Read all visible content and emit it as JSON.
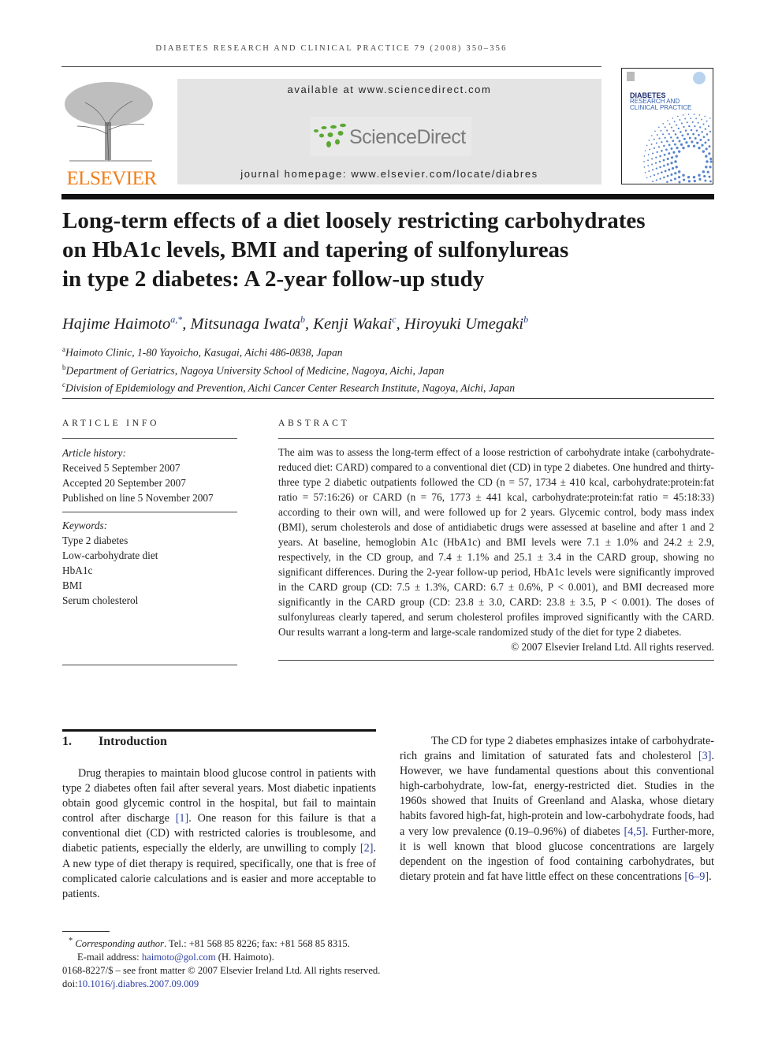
{
  "running_head": "DIABETES RESEARCH AND CLINICAL PRACTICE 79 (2008) 350–356",
  "banner": {
    "available": "available at www.sciencedirect.com",
    "sciencedirect": "ScienceDirect",
    "homepage": "journal homepage: www.elsevier.com/locate/diabres",
    "publisher": "ELSEVIER",
    "brand_color": "#f07f1a",
    "sd_green": "#5aa832"
  },
  "cover": {
    "line1": "DIABETES",
    "line2": "RESEARCH AND",
    "line3": "CLINICAL PRACTICE"
  },
  "title": [
    "Long-term effects of a diet loosely restricting carbohydrates",
    "on HbA1c levels, BMI and tapering of sulfonylureas",
    "in type 2 diabetes: A 2-year follow-up study"
  ],
  "authors": [
    {
      "name": "Hajime Haimoto",
      "sup": "a,*"
    },
    {
      "name": "Mitsunaga Iwata",
      "sup": "b"
    },
    {
      "name": "Kenji Wakai",
      "sup": "c"
    },
    {
      "name": "Hiroyuki Umegaki",
      "sup": "b"
    }
  ],
  "affiliations": [
    {
      "sup": "a",
      "text": "Haimoto Clinic, 1-80 Yayoicho, Kasugai, Aichi 486-0838, Japan"
    },
    {
      "sup": "b",
      "text": "Department of Geriatrics, Nagoya University School of Medicine, Nagoya, Aichi, Japan"
    },
    {
      "sup": "c",
      "text": "Division of Epidemiology and Prevention, Aichi Cancer Center Research Institute, Nagoya, Aichi, Japan"
    }
  ],
  "article_info": {
    "heading": "ARTICLE INFO",
    "history_label": "Article history:",
    "history": [
      "Received 5 September 2007",
      "Accepted 20 September 2007",
      "Published on line 5 November 2007"
    ],
    "keywords_label": "Keywords:",
    "keywords": [
      "Type 2 diabetes",
      "Low-carbohydrate diet",
      "HbA1c",
      "BMI",
      "Serum cholesterol"
    ]
  },
  "abstract": {
    "heading": "ABSTRACT",
    "text": "The aim was to assess the long-term effect of a loose restriction of carbohydrate intake (carbohydrate-reduced diet: CARD) compared to a conventional diet (CD) in type 2 diabetes. One hundred and thirty-three type 2 diabetic outpatients followed the CD (n = 57, 1734 ± 410 kcal, carbohydrate:protein:fat ratio = 57:16:26) or CARD (n = 76, 1773 ± 441 kcal, carbohydrate:protein:fat ratio = 45:18:33) according to their own will, and were followed up for 2 years. Glycemic control, body mass index (BMI), serum cholesterols and dose of antidiabetic drugs were assessed at baseline and after 1 and 2 years. At baseline, hemoglobin A1c (HbA1c) and BMI levels were 7.1 ± 1.0% and 24.2 ± 2.9, respectively, in the CD group, and 7.4 ± 1.1% and 25.1 ± 3.4 in the CARD group, showing no significant differences. During the 2-year follow-up period, HbA1c levels were significantly improved in the CARD group (CD: 7.5 ± 1.3%, CARD: 6.7 ± 0.6%, P < 0.001), and BMI decreased more significantly in the CARD group (CD: 23.8 ± 3.0, CARD: 23.8 ± 3.5, P < 0.001). The doses of sulfonylureas clearly tapered, and serum cholesterol profiles improved significantly with the CARD. Our results warrant a long-term and large-scale randomized study of the diet for type 2 diabetes.",
    "copyright": "© 2007 Elsevier Ireland Ltd. All rights reserved."
  },
  "introduction": {
    "heading_num": "1.",
    "heading": "Introduction",
    "left": [
      [
        {
          "t": "Drug therapies to maintain blood glucose control in patients with type 2 diabetes often fail after several years. Most diabetic inpatients obtain good glycemic control in the hospital, but fail to maintain control after discharge "
        },
        {
          "t": "[1]",
          "link": true
        },
        {
          "t": ". One reason for this failure is that a conventional diet (CD) with restricted calories is troublesome, and diabetic patients, especially the elderly, are unwilling to comply "
        },
        {
          "t": "[2]",
          "link": true
        },
        {
          "t": ". A new type of diet therapy is required, specifically, one that is free of complicated calorie calculations and is easier and more acceptable to patients."
        }
      ]
    ],
    "right": [
      [
        {
          "t": "The CD for type 2 diabetes emphasizes intake of carbohydrate-rich grains and limitation of saturated fats and cholesterol "
        },
        {
          "t": "[3]",
          "link": true
        },
        {
          "t": ". However, we have fundamental questions about this conventional high-carbohydrate, low-fat, energy-restricted diet. Studies in the 1960s showed that Inuits of Greenland and Alaska, whose dietary habits favored high-fat, high-protein and low-carbohydrate foods, had a very low prevalence (0.19–0.96%) of diabetes "
        },
        {
          "t": "[4,5]",
          "link": true
        },
        {
          "t": ". Further-more, it is well known that blood glucose concentrations are largely dependent on the ingestion of food containing carbohydrates, but dietary protein and fat have little effect on these concentrations "
        },
        {
          "t": "[6–9]",
          "link": true
        },
        {
          "t": "."
        }
      ]
    ]
  },
  "footnotes": {
    "corr_mark": "*",
    "corr_label": "Corresponding author",
    "corr_text": ". Tel.: +81 568 85 8226; fax: +81 568 85 8315.",
    "email_label": "E-mail address: ",
    "email": "haimoto@gol.com",
    "email_suffix": " (H. Haimoto).",
    "issn": "0168-8227/$ – see front matter © 2007 Elsevier Ireland Ltd. All rights reserved.",
    "doi_label": "doi:",
    "doi": "10.1016/j.diabres.2007.09.009"
  }
}
